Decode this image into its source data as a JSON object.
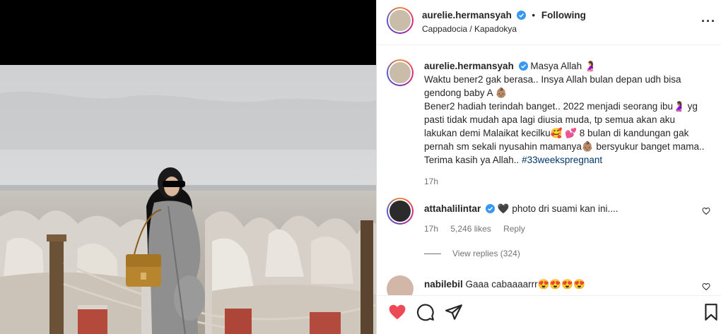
{
  "post": {
    "username": "aurelie.hermansyah",
    "follow_status": "Following",
    "location": "Cappadocia / Kapadokya",
    "more_label": "···"
  },
  "caption": {
    "username": "aurelie.hermansyah",
    "text_1": "Masya Allah 🤰",
    "text_2": "Waktu bener2 gak berasa.. Insya Allah bulan depan udh bisa gendong baby A 👶🏽",
    "text_3": "Bener2 hadiah terindah banget.. 2022 menjadi seorang ibu🤰🏽 yg pasti tidak mudah apa lagi diusia muda, tp semua akan aku lakukan demi Malaikat kecilku🥰 💕 8 bulan di kandungan gak pernah sm sekali nyusahin mamanya👶🏽 bersyukur banget mama.. Terima kasih ya Allah..",
    "hashtag": "#33weekspregnant",
    "time": "17h"
  },
  "comments": [
    {
      "username": "attahalilintar",
      "text": "🖤 photo dri suami kan ini....",
      "time": "17h",
      "likes": "5,246 likes",
      "reply_label": "Reply",
      "view_replies": "View replies (324)"
    },
    {
      "username": "nabilebil",
      "text": "Gaaa cabaaaarrr😍😍😍😍"
    }
  ],
  "icons": {
    "like": "heart-icon",
    "comment": "comment-icon",
    "share": "share-icon",
    "save": "bookmark-icon"
  },
  "colors": {
    "like_red": "#ed4956",
    "verified_blue": "#3897f0",
    "hashtag_blue": "#00376b"
  }
}
